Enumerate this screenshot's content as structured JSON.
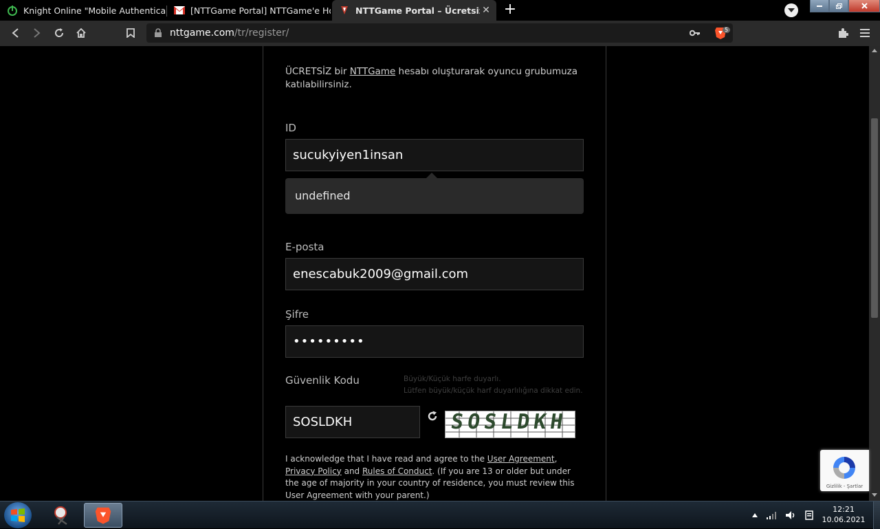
{
  "tabs": [
    {
      "title": "Knight Online \"Mobile Authentication",
      "active": false
    },
    {
      "title": "[NTTGame Portal] NTTGame'e Hoş Ge",
      "active": false
    },
    {
      "title": "NTTGame Portal – Ücretsiz Online",
      "active": true
    }
  ],
  "tab_close": "✕",
  "new_tab": "+",
  "omnibox": {
    "host": "nttgame.com",
    "path": "/tr/register/"
  },
  "brave_badge": "5",
  "page": {
    "intro_prefix": "ÜCRETSİZ bir ",
    "intro_link": "NTTGame",
    "intro_suffix": " hesabı oluşturarak oyuncu grubumuza katılabilirsiniz.",
    "id_label": "ID",
    "id_value": "sucukyiyen1insan",
    "tooltip": "undefined",
    "email_label": "E-posta",
    "email_value": "enescabuk2009@gmail.com",
    "password_label": "Şifre",
    "password_value": "•••••••••",
    "captcha_label": "Güvenlik Kodu",
    "captcha_hint_1": "Büyük/Küçük harfe duyarlı.",
    "captcha_hint_2": "Lütfen büyük/küçük harf duyarlılığına dikkat edin.",
    "captcha_value": "SOSLDKH",
    "captcha_image_text": "SOSLDKH",
    "legal_1": "I acknowledge that I have read and agree to the ",
    "legal_link_1": "User Agreement",
    "legal_2": ", ",
    "legal_link_2": "Privacy Policy",
    "legal_3": " and ",
    "legal_link_3": "Rules of Conduct",
    "legal_4": ". (If you are 13 or older but under the age of majority in your country of residence, you must review this User Agreement with your parent.)"
  },
  "recaptcha": {
    "footer": "Gizlilik - Şartlar"
  },
  "taskbar": {
    "time": "12:21",
    "date": "10.06.2021"
  },
  "colors": {
    "brave": "#fb542b",
    "accent_green": "#3fb950"
  }
}
